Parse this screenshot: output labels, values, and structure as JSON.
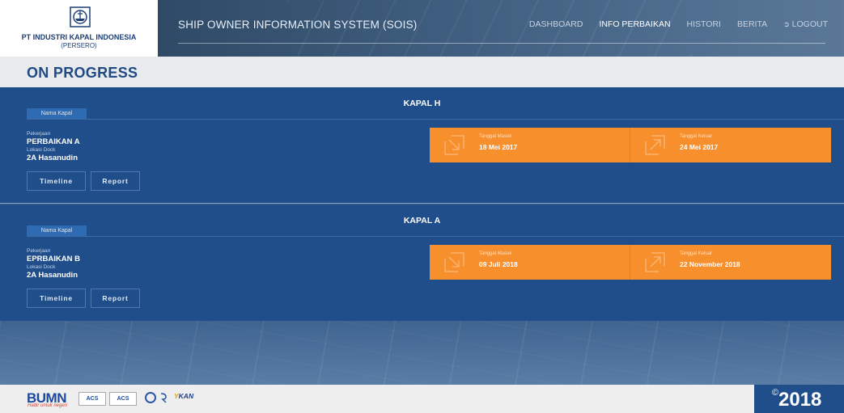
{
  "company": {
    "name": "PT INDUSTRI KAPAL INDONESIA",
    "sub": "(PERSERO)",
    "emblem_icon": "ship-company-emblem-icon"
  },
  "header": {
    "system_title": "SHIP OWNER INFORMATION SYSTEM (SOIS)",
    "nav": [
      {
        "label": "DASHBOARD",
        "active": false
      },
      {
        "label": "INFO PERBAIKAN",
        "active": true
      },
      {
        "label": "HISTORI",
        "active": false
      },
      {
        "label": "BERITA",
        "active": false
      }
    ],
    "logout_label": "LOGOUT",
    "logout_icon": "logout-icon"
  },
  "page": {
    "title": "ON PROGRESS"
  },
  "projects": [
    {
      "ship_label": "Nama Kapal",
      "ship_name": "KAPAL H",
      "job_label": "Pekerjaan",
      "job_value": "PERBAIKAN A",
      "dock_label": "Lokasi Dock",
      "dock_value": "2A Hasanudin",
      "timeline_label": "Timeline",
      "report_label": "Report",
      "date_in_label": "Tanggal Masuk",
      "date_in": "18 Mei 2017",
      "date_out_label": "Tanggal Keluar",
      "date_out": "24 Mei 2017"
    },
    {
      "ship_label": "Nama Kapal",
      "ship_name": "KAPAL A",
      "job_label": "Pekerjaan",
      "job_value": "EPRBAIKAN B",
      "dock_label": "Lokasi Dock",
      "dock_value": "2A Hasanudin",
      "timeline_label": "Timeline",
      "report_label": "Report",
      "date_in_label": "Tanggal Masuk",
      "date_in": "09 Juli 2018",
      "date_out_label": "Tanggal Keluar",
      "date_out": "22 November 2018"
    }
  ],
  "footer": {
    "bumn": "BUMN",
    "bumn_tagline": "Hadir untuk negeri",
    "cert_a": "ACS",
    "cert_b": "ACS",
    "kan": "KAN",
    "kan_prefix": "Y",
    "year_symbol": "©",
    "year": "2018"
  },
  "colors": {
    "primary": "#1f4e8a",
    "accent": "#f78f2d",
    "title": "#1f4a83"
  }
}
